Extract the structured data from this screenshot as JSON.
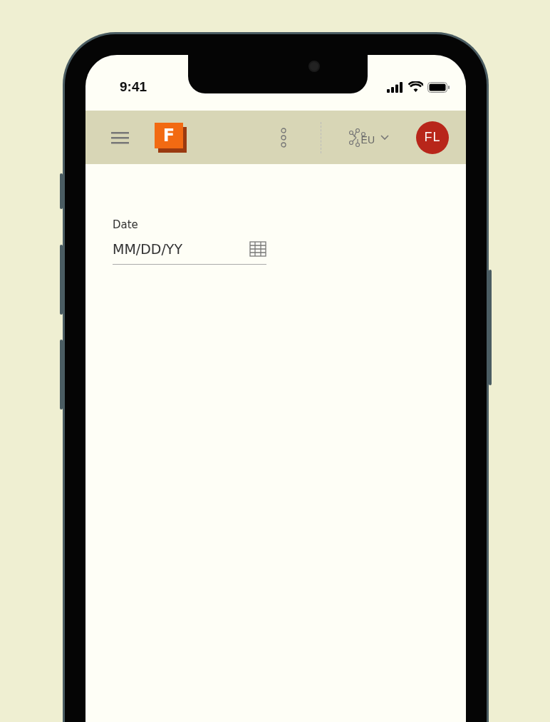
{
  "status_bar": {
    "time": "9:41"
  },
  "header": {
    "logo_letter": "F",
    "region": "EU",
    "avatar_initials": "FL"
  },
  "form": {
    "fields": [
      {
        "label": "Date",
        "placeholder": "MM/DD/YY"
      }
    ]
  }
}
